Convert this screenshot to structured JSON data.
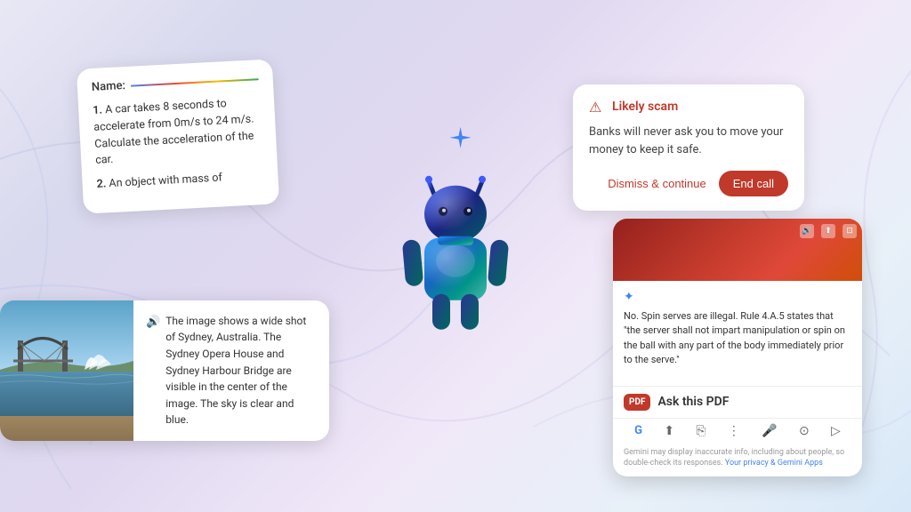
{
  "background": {
    "gradient_start": "#e8e8f5",
    "gradient_end": "#d8e8f8"
  },
  "quiz_card": {
    "name_label": "Name:",
    "items": [
      {
        "num": "1.",
        "text": "A car takes 8 seconds to accelerate from 0m/s to 24 m/s. Calculate the acceleration of the car."
      },
      {
        "num": "2.",
        "text": "An object with mass of"
      }
    ]
  },
  "scam_card": {
    "icon": "⚠",
    "title": "Likely scam",
    "body": "Banks will never ask you to move your money to keep it safe.",
    "dismiss_label": "Dismiss & continue",
    "end_call_label": "End call"
  },
  "sydney_card": {
    "icon": "🔊",
    "text": "The image shows a wide shot of Sydney, Australia. The Sydney Opera House and Sydney Harbour Bridge are visible in the center of the image. The sky is clear and blue."
  },
  "pdf_card": {
    "gemini_icon": "✦",
    "body_text": "No. Spin serves are illegal. Rule 4.A.5 states that \"the server shall not impart manipulation or spin on the ball with any part of the body immediately prior to the serve.\"",
    "pdf_badge": "PDF",
    "ask_label": "Ask this PDF",
    "footer": "Gemini may display inaccurate info, including about people, so double-check its responses.",
    "footer_link1": "Your privacy",
    "footer_link2": "Gemini Apps",
    "toolbar_icons": [
      "🔊",
      "⬆",
      "⊡"
    ],
    "bottom_icons": [
      "G",
      "⬆",
      "⎘",
      "⋮"
    ]
  },
  "android_mascot": {
    "sparkle_icon": "✦",
    "alt": "Android mascot 3D figure"
  }
}
